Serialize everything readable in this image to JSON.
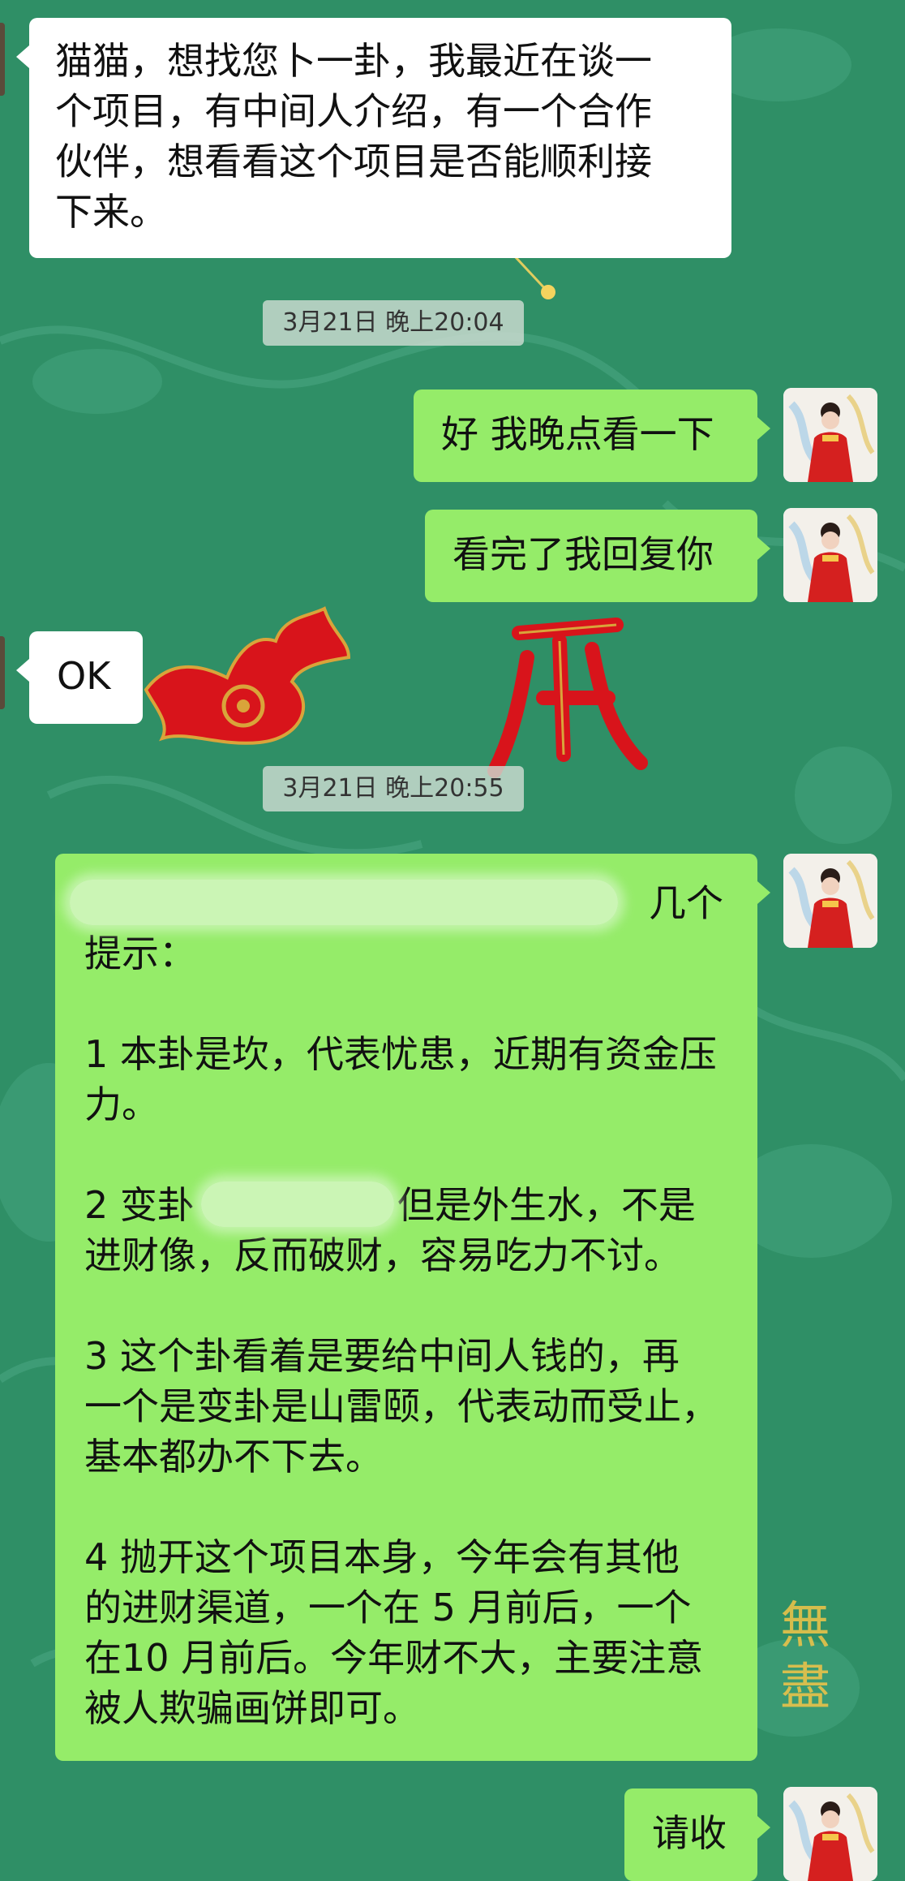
{
  "messages": {
    "m1": {
      "lines": [
        "猫猫，想找您卜一卦，我最近在谈一",
        "个项目，有中间人介绍，有一个合作",
        "伙伴，想看看这个项目是否能顺利接",
        "下来。"
      ]
    },
    "time1": "3月21日 晚上20:04",
    "m2": "好 我晚点看一下",
    "m3": "看完了我回复你",
    "m4": "OK",
    "time2": "3月21日 晚上20:55",
    "m5": {
      "p0_l1_tail": "几个",
      "p0_l2": "提示：",
      "p1_l1": "1 本卦是坎，代表忧患，近期有资金压",
      "p1_l2": "力。",
      "p2_l1_head": "2 变卦",
      "p2_l1_tail": "但是外生水，不是",
      "p2_l2": "进财像，反而破财，容易吃力不讨。",
      "p3_l1": "3 这个卦看着是要给中间人钱的，再",
      "p3_l2": "一个是变卦是山雷颐，代表动而受止，",
      "p3_l3": "基本都办不下去。",
      "p4_l1": "4 抛开这个项目本身，今年会有其他",
      "p4_l2": "的进财渠道，一个在 5 月前后，一个",
      "p4_l3": "在10 月前后。今年财不大，主要注意",
      "p4_l4": "被人欺骗画饼即可。"
    },
    "m6": "请收"
  },
  "watermark": "無盡",
  "colors": {
    "background": "#2f8f66",
    "incoming_bubble": "#ffffff",
    "outgoing_bubble": "#95ec69",
    "stamp_red": "#d8141b",
    "stamp_gold": "#d9a43a"
  }
}
